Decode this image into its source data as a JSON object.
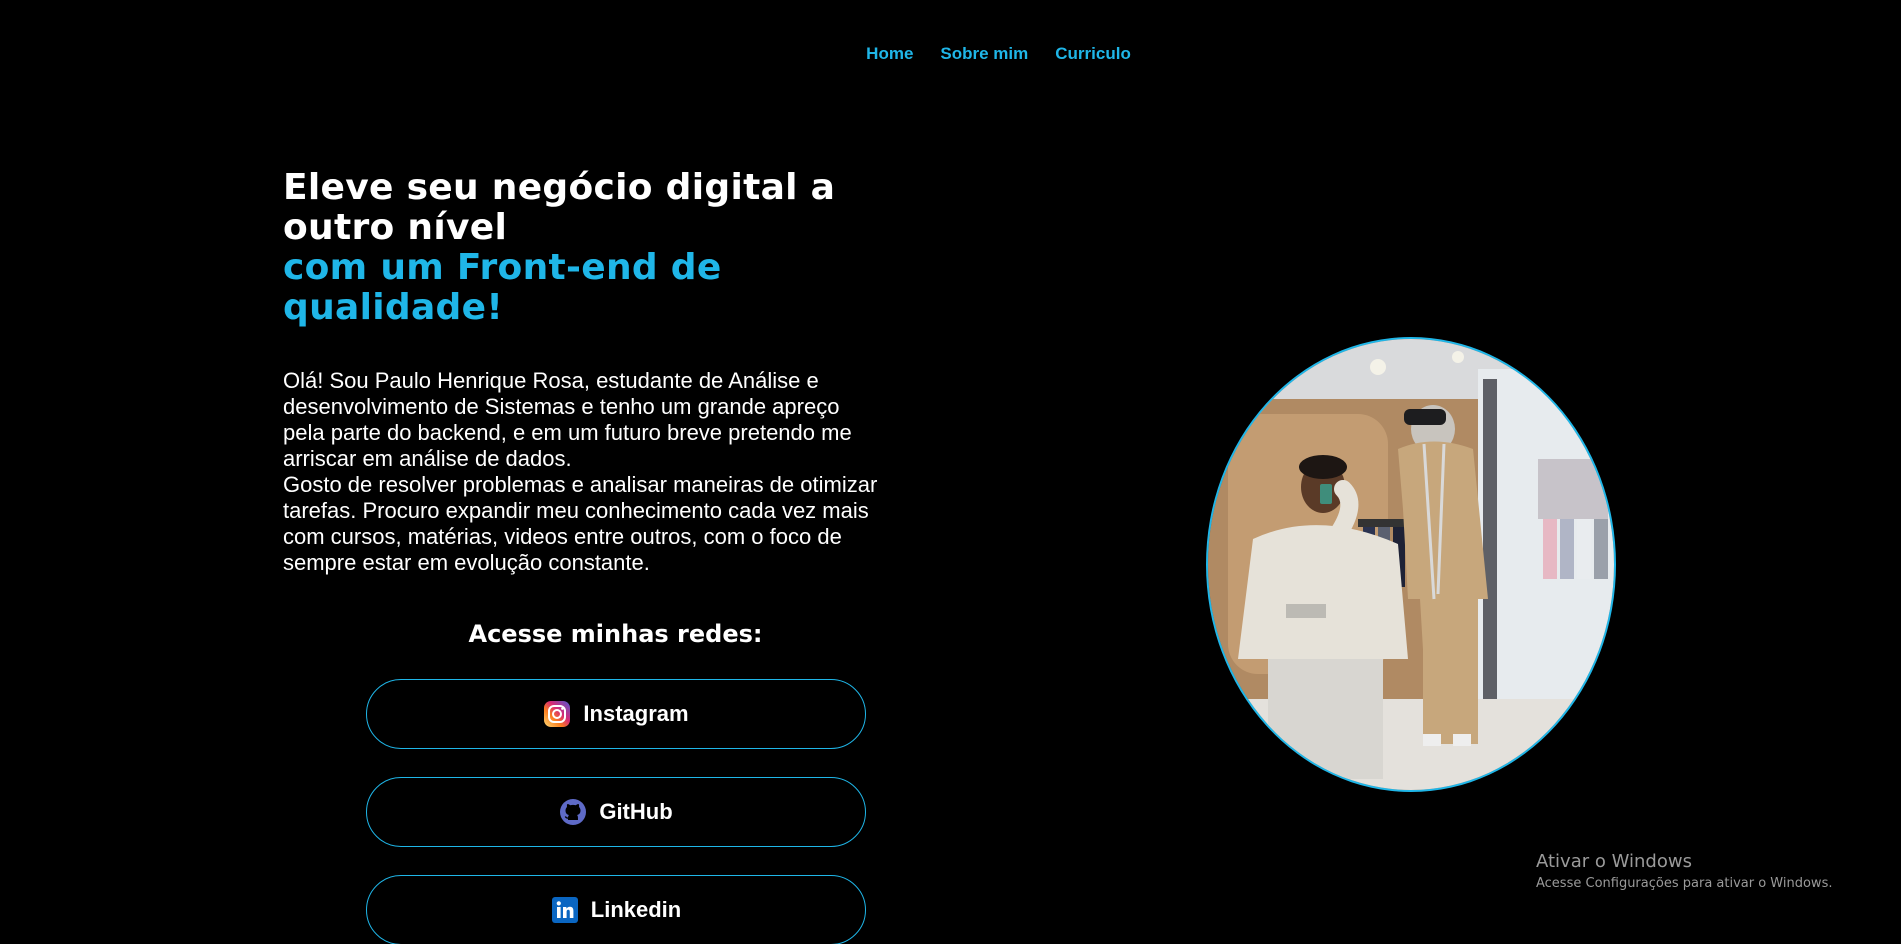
{
  "nav": {
    "items": [
      {
        "label": "Home"
      },
      {
        "label": "Sobre mim"
      },
      {
        "label": "Curriculo"
      }
    ]
  },
  "hero": {
    "headline_line1": "Eleve seu negócio digital a",
    "headline_line2": "outro nível",
    "headline_accent1": "com um Front-end de",
    "headline_accent2": "qualidade!",
    "bio": "Olá! Sou Paulo Henrique Rosa, estudante de Análise e\ndesenvolvimento de Sistemas e tenho um grande apreço\npela parte do backend, e em um futuro breve pretendo me\narriscar em análise de dados.\nGosto de resolver problemas e analisar maneiras de otimizar\ntarefas. Procuro expandir meu conhecimento cada vez mais\ncom cursos, matérias, videos entre outros, com o foco de\nsempre estar em evolução constante."
  },
  "social": {
    "title": "Acesse minhas redes:",
    "instagram": {
      "label": "Instagram",
      "icon": "instagram-icon"
    },
    "github": {
      "label": "GitHub",
      "icon": "github-icon"
    },
    "linkedin": {
      "label": "Linkedin",
      "icon": "linkedin-icon"
    }
  },
  "profile": {
    "photo_alt": "profile-photo"
  },
  "watermark": {
    "title": "Ativar o Windows",
    "subtitle": "Acesse Configurações para ativar o Windows."
  },
  "colors": {
    "accent": "#1fb6e8",
    "background": "#000000",
    "text": "#ffffff"
  }
}
